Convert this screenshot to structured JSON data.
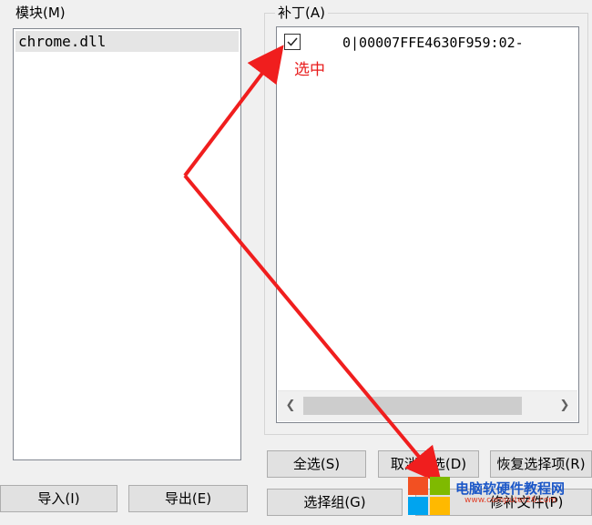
{
  "modules_group": {
    "title": "模块(M)",
    "items": [
      "chrome.dll"
    ]
  },
  "patch_group": {
    "title": "补丁(A)",
    "items": [
      {
        "checked": true,
        "text": "0|00007FFE4630F959:02-"
      }
    ],
    "scroll_left_icon": "chevron-left-icon",
    "scroll_right_icon": "chevron-right-icon"
  },
  "annotation": {
    "label": "选中",
    "color": "#e81b1b"
  },
  "buttons": {
    "import": "导入(I)",
    "export": "导出(E)",
    "select_all": "全选(S)",
    "deselect_all": "取消全选(D)",
    "restore_selection": "恢复选择项(R)",
    "select_group": "选择组(G)",
    "patch_file": "修补文件(P)"
  },
  "watermark": {
    "title": "电脑软硬件教程网",
    "url": "www.computer26.com",
    "logo": "windows-logo-icon"
  }
}
